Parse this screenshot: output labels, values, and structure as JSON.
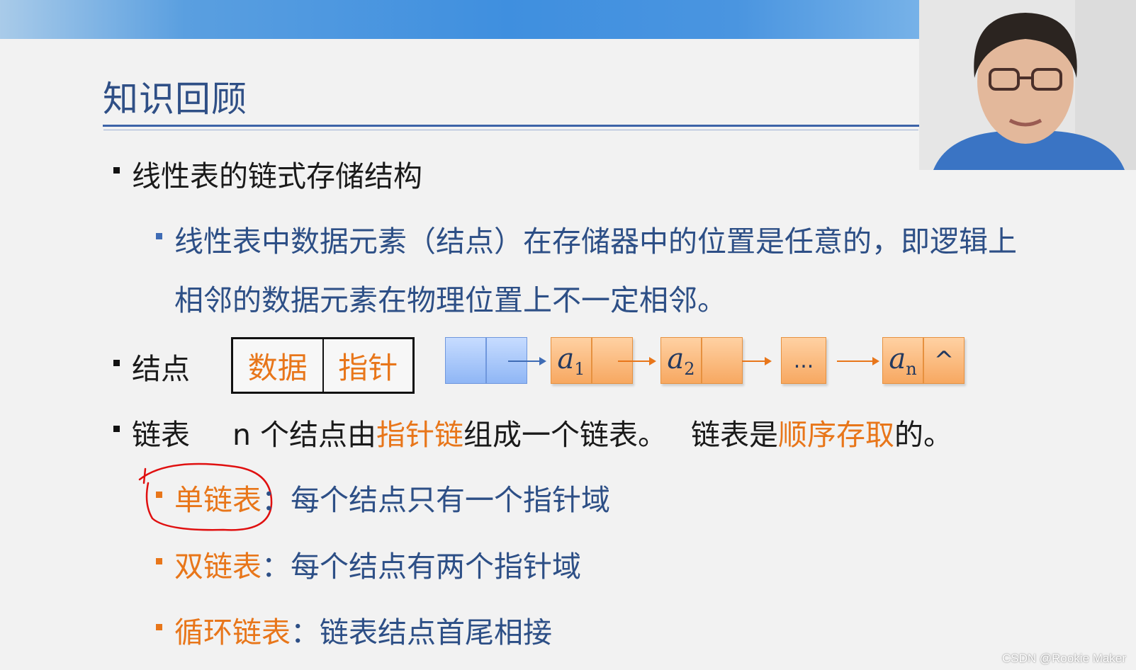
{
  "slide": {
    "title": "知识回顾",
    "item1": "线性表的链式存储结构",
    "item1_sub_line1": "线性表中数据元素（结点）在存储器中的位置是任意的，即逻辑上",
    "item1_sub_line2": "相邻的数据元素在物理位置上不一定相邻。",
    "node_label": "结点",
    "node_field_data": "数据",
    "node_field_pointer": "指针",
    "diagram": {
      "a1_base": "a",
      "a1_sub": "1",
      "a2_base": "a",
      "a2_sub": "2",
      "ellipsis": "...",
      "an_base": "a",
      "an_sub": "n",
      "null_symbol": "^"
    },
    "list_label": "链表",
    "list_desc_part1": "n 个结点由",
    "list_desc_highlight1": "指针链",
    "list_desc_part2": "组成一个链表。",
    "list_desc_part3": "链表是",
    "list_desc_highlight2": "顺序存取",
    "list_desc_part4": "的。",
    "singly_term": "单链表",
    "singly_desc": "：每个结点只有一个指针域",
    "doubly_term": "双链表",
    "doubly_desc": "：每个结点有两个指针域",
    "circular_term": "循环链表",
    "circular_desc": "：链表结点首尾相接"
  },
  "watermark": "CSDN @Rookie Maker",
  "colors": {
    "title_blue": "#2f4f86",
    "highlight_orange": "#e8761a",
    "annotation_red": "#e01010"
  }
}
